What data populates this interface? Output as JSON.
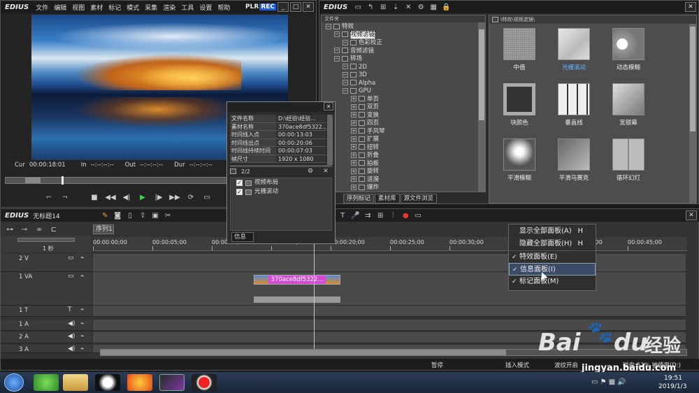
{
  "app": {
    "name": "EDIUS"
  },
  "player": {
    "menu": [
      "文件",
      "编辑",
      "视图",
      "素材",
      "标记",
      "模式",
      "采集",
      "渲染",
      "工具",
      "设置",
      "帮助"
    ],
    "plr": "PLR",
    "rec": "REC",
    "timecodes": {
      "cur_label": "Cur",
      "cur": "00:00:18:01",
      "in_label": "In",
      "in": "--:--:--:--",
      "out_label": "Out",
      "out": "--:--:--:--",
      "dur_label": "Dur",
      "dur": "--:--:--:--"
    }
  },
  "effects": {
    "title": "EDIUS",
    "folder_header": "文件夹",
    "path": "\\特效\\视频滤镜\\",
    "tree": [
      {
        "label": "特效",
        "level": 0
      },
      {
        "label": "视频滤镜",
        "level": 1,
        "selected": true
      },
      {
        "label": "色彩校正",
        "level": 2
      },
      {
        "label": "音频滤镜",
        "level": 1
      },
      {
        "label": "转场",
        "level": 1
      },
      {
        "label": "2D",
        "level": 2
      },
      {
        "label": "3D",
        "level": 2
      },
      {
        "label": "Alpha",
        "level": 2
      },
      {
        "label": "GPU",
        "level": 2
      },
      {
        "label": "单页",
        "level": 3
      },
      {
        "label": "双页",
        "level": 3
      },
      {
        "label": "变换",
        "level": 3
      },
      {
        "label": "四页",
        "level": 3
      },
      {
        "label": "手风琴",
        "level": 3
      },
      {
        "label": "扩展",
        "level": 3
      },
      {
        "label": "扭转",
        "level": 3
      },
      {
        "label": "折叠",
        "level": 3
      },
      {
        "label": "拍板",
        "level": 3
      },
      {
        "label": "旋转",
        "level": 3
      },
      {
        "label": "涟漪",
        "level": 3
      },
      {
        "label": "爆炸",
        "level": 3
      }
    ],
    "tabs": [
      "序列标记",
      "素材库",
      "源文件浏览"
    ],
    "items": [
      "中值",
      "光栅滚动",
      "动态模糊",
      "块颜色",
      "垂直线",
      "宽银幕",
      "平滑模糊",
      "平滑马赛克",
      "循环幻灯"
    ]
  },
  "info": {
    "rows": [
      {
        "k": "文件名称",
        "v": "D:\\经验\\经验..."
      },
      {
        "k": "素材名称",
        "v": "370ace8df5322..."
      },
      {
        "k": "时间线入点",
        "v": "00:00:13:03"
      },
      {
        "k": "时间线出点",
        "v": "00:00:20:06"
      },
      {
        "k": "时间线持续时间",
        "v": "00:00:07:03"
      },
      {
        "k": "帧尺寸",
        "v": "1920 x 1080"
      }
    ],
    "count": "2/2",
    "filters": [
      "视频布局",
      "光栅滚动"
    ],
    "tab": "信息"
  },
  "timeline": {
    "logo": "EDIUS",
    "project": "无标题14",
    "sequence_tab": "序列1",
    "scale": "1 秒",
    "ruler": [
      "00:00:00;00",
      "00:00:05;00",
      "00:00:10;00",
      "00:00:15;00",
      "00:00:20;00",
      "00:00:25;00",
      "00:00:30;00",
      "00:00:35;00",
      "00:00:40;00",
      "00:00:45;00"
    ],
    "tracks": [
      "2 V",
      "1 VA",
      "1 T",
      "1 A",
      "2 A",
      "3 A"
    ],
    "clip_name": "370ace8df5322...",
    "status": {
      "pause": "暂停",
      "insert": "插入模式",
      "ripple": "波纹开启",
      "disk": "磁盘:52% 被使用(D:)"
    }
  },
  "context_menu": {
    "items": [
      {
        "label": "显示全部面板(A)",
        "shortcut": "H",
        "check": false
      },
      {
        "label": "隐藏全部面板(H)",
        "shortcut": "H",
        "check": false
      },
      {
        "label": "特效面板(E)",
        "shortcut": "",
        "check": true
      },
      {
        "label": "信息面板(I)",
        "shortcut": "",
        "check": true,
        "highlight": true
      },
      {
        "label": "标记面板(M)",
        "shortcut": "",
        "check": true
      }
    ]
  },
  "taskbar": {
    "time": "19:51",
    "date": "2019/1/3"
  },
  "watermark": {
    "brand": "Bai",
    "suffix": "经验",
    "url": "jingyan.baidu.com"
  }
}
